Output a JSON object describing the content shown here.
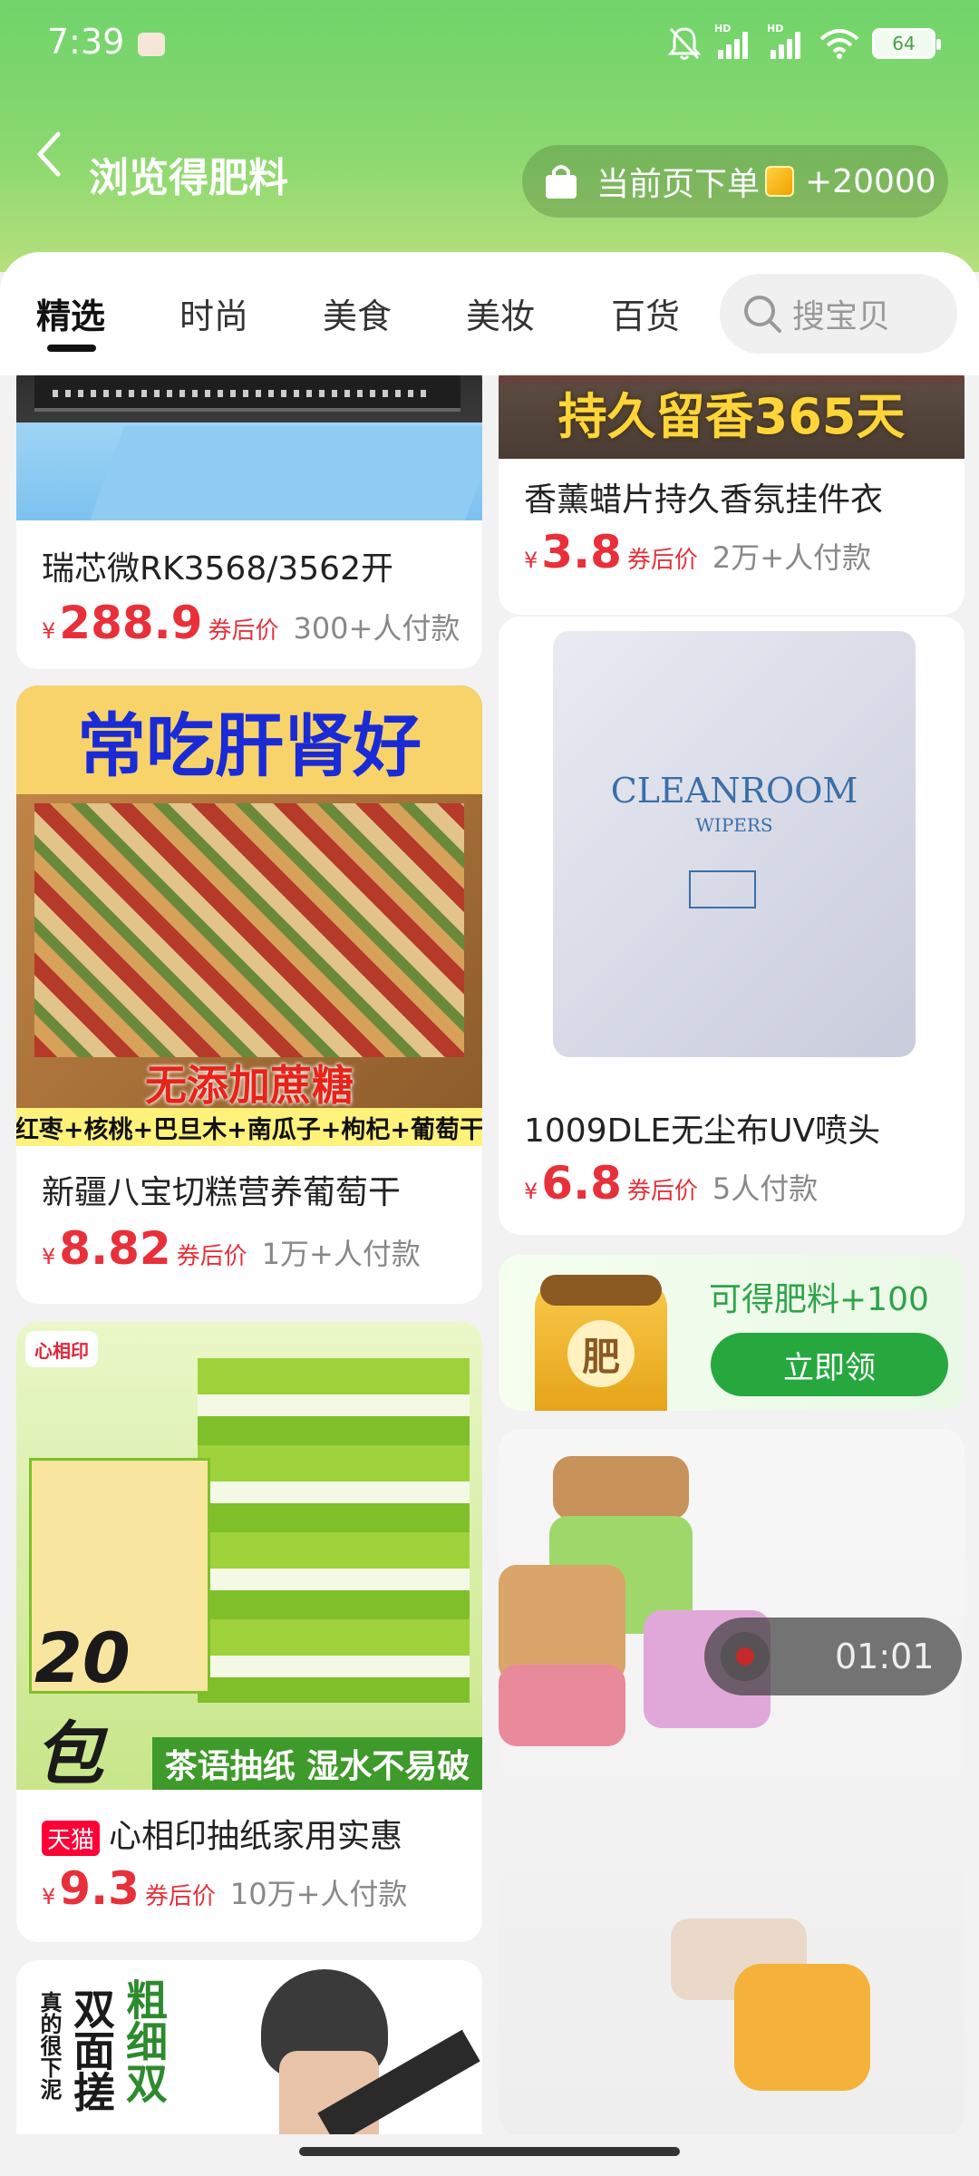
{
  "status": {
    "time": "7:39",
    "battery": "64",
    "signal1": "HD",
    "signal2": "HD"
  },
  "nav": {
    "title": "浏览得肥料",
    "promo_text": "当前页下单",
    "promo_reward": "+20000"
  },
  "tabs": [
    {
      "label": "精选",
      "active": true
    },
    {
      "label": "时尚"
    },
    {
      "label": "美食"
    },
    {
      "label": "美妆"
    },
    {
      "label": "百货"
    }
  ],
  "search": {
    "placeholder": "搜宝贝"
  },
  "products": [
    {
      "title": "瑞芯微RK3568/3562开",
      "currency": "¥",
      "price": "288.9",
      "after": "券后价",
      "buyers": "300+人付款"
    },
    {
      "title": "香薰蜡片持久香氛挂件衣",
      "image_text": "持久留香365天",
      "currency": "¥",
      "price": "3.8",
      "after": "券后价",
      "buyers": "2万+人付款"
    },
    {
      "title": "新疆八宝切糕营养葡萄干",
      "image_text": "常吃肝肾好",
      "image_text2": "无添加蔗糖",
      "image_text3": "红枣+核桃+巴旦木+南瓜子+枸杞+葡萄干",
      "currency": "¥",
      "price": "8.82",
      "after": "券后价",
      "buyers": "1万+人付款"
    },
    {
      "title": "1009DLE无尘布UV喷头",
      "image_text": "CLEANROOM",
      "image_text2": "WIPERS",
      "currency": "¥",
      "price": "6.8",
      "after": "券后价",
      "buyers": "5人付款"
    },
    {
      "title": "心相印抽纸家用实惠",
      "badge": "天猫",
      "image_text": "20包",
      "image_text2": "茶语抽纸 湿水不易破",
      "image_text3": "心相印",
      "currency": "¥",
      "price": "9.3",
      "after": "券后价",
      "buyers": "10万+人付款"
    },
    {
      "image_text": "双面搓",
      "image_text2": "粗细双",
      "image_text3": "真的很下泥"
    }
  ],
  "fertilizer_card": {
    "text": "可得肥料+100",
    "button": "立即领",
    "jar_label": "肥"
  },
  "video": {
    "time": "01:01"
  },
  "colors": {
    "accent_green": "#2fb24a",
    "price_red": "#e8303a",
    "header_green": "#7dd46c"
  }
}
